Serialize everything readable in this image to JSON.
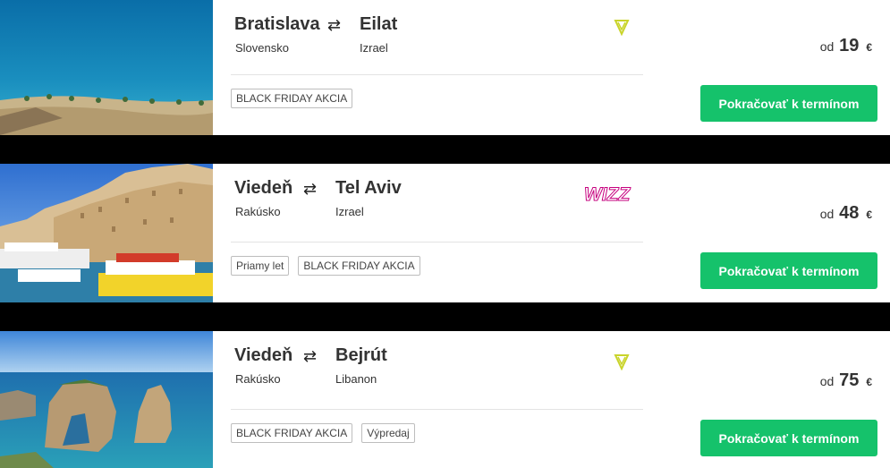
{
  "flights": [
    {
      "from_city": "Bratislava",
      "from_country": "Slovensko",
      "to_city": "Eilat",
      "to_country": "Izrael",
      "airline_icon": "ryanair-harp-icon",
      "tags": [
        "BLACK FRIDAY AKCIA"
      ],
      "price_prefix": "od",
      "price": "19",
      "currency": "€",
      "cta_label": "Pokračovať k termínom"
    },
    {
      "from_city": "Viedeň",
      "from_country": "Rakúsko",
      "to_city": "Tel Aviv",
      "to_country": "Izrael",
      "airline_logo_text": "WIZZ",
      "tags": [
        "Priamy let",
        "BLACK FRIDAY AKCIA"
      ],
      "price_prefix": "od",
      "price": "48",
      "currency": "€",
      "cta_label": "Pokračovať k termínom"
    },
    {
      "from_city": "Viedeň",
      "from_country": "Rakúsko",
      "to_city": "Bejrút",
      "to_country": "Libanon",
      "airline_icon": "ryanair-harp-icon",
      "tags": [
        "BLACK FRIDAY AKCIA",
        "Výpredaj"
      ],
      "price_prefix": "od",
      "price": "75",
      "currency": "€",
      "cta_label": "Pokračovať k termínom"
    }
  ],
  "colors": {
    "cta": "#15c26b",
    "ryanair": "#c9d42a",
    "wizz": "#c6007e"
  }
}
